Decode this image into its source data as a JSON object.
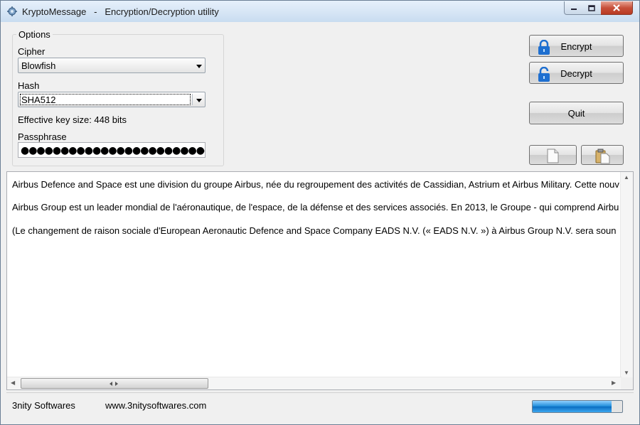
{
  "window": {
    "app_name": "KryptoMessage",
    "separator": "-",
    "subtitle": "Encryption/Decryption utility"
  },
  "options": {
    "legend": "Options",
    "cipher_label": "Cipher",
    "cipher_value": "Blowfish",
    "hash_label": "Hash",
    "hash_value": "SHA512",
    "key_size_text": "Effective key size: 448 bits",
    "passphrase_label": "Passphrase",
    "passphrase_value": "●●●●●●●●●●●●●●●●●●●●●●●●●●●●●●●●"
  },
  "buttons": {
    "encrypt": "Encrypt",
    "decrypt": "Decrypt",
    "quit": "Quit"
  },
  "message": {
    "lines": [
      "Airbus Defence and Space est une division du groupe Airbus, née du regroupement des activités de Cassidian, Astrium et Airbus Military. Cette nouv",
      "Airbus Group est un leader mondial de l'aéronautique, de l'espace, de la défense et des services associés. En 2013, le Groupe - qui comprend Airbu",
      "(Le changement de raison sociale d'European Aeronautic Defence and Space Company EADS N.V. (« EADS N.V. ») à Airbus Group N.V. sera soun"
    ]
  },
  "status": {
    "company": "3nity Softwares",
    "url": "www.3nitysoftwares.com",
    "progress": 0.88
  },
  "colors": {
    "accent": "#1c8ad8",
    "lock": "#1e6fd0"
  }
}
